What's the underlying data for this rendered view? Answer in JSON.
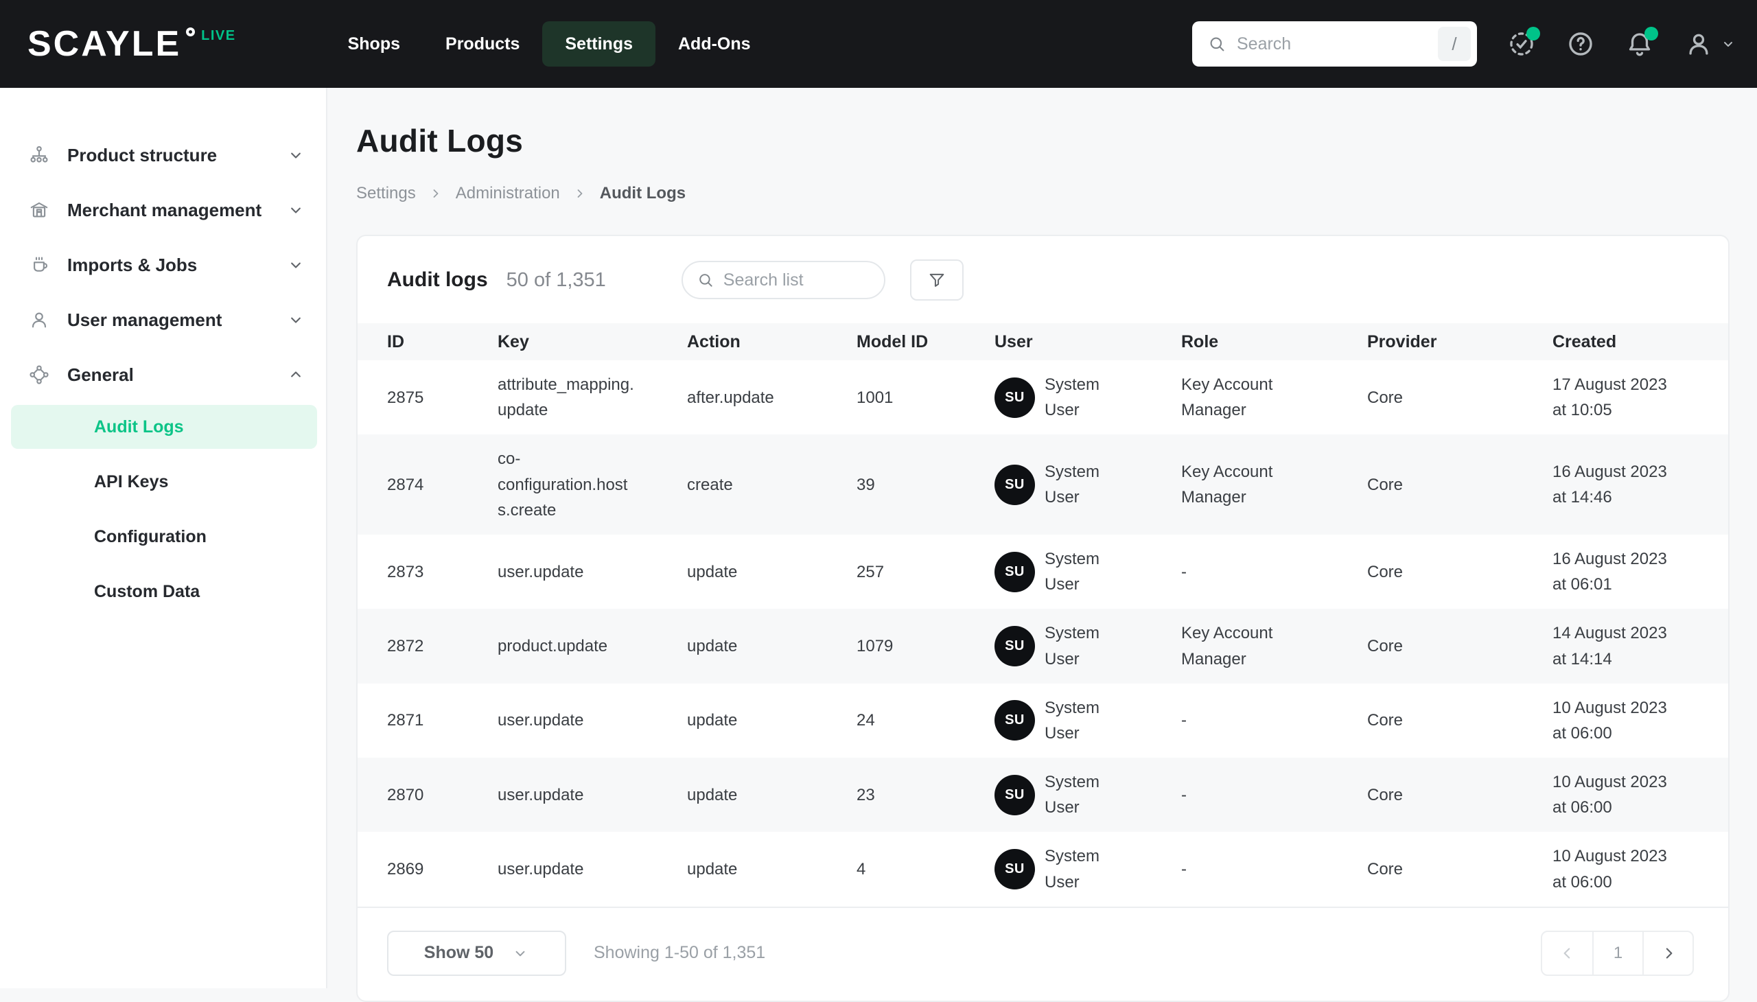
{
  "colors": {
    "accent_green": "#00C389",
    "topbar_bg": "#17181B",
    "topnav_active_bg": "#1E3529",
    "sidebar_active_bg": "#E4F8EF",
    "sidebar_active_text": "#0CC487",
    "page_bg": "#F7F8F9",
    "avatar_bg": "#0E1013"
  },
  "topbar": {
    "logo_text": "SCAYLE",
    "env_badge": "LIVE",
    "nav_items": [
      {
        "label": "Shops",
        "active": false
      },
      {
        "label": "Products",
        "active": false
      },
      {
        "label": "Settings",
        "active": true
      },
      {
        "label": "Add-Ons",
        "active": false
      }
    ],
    "search": {
      "placeholder": "Search",
      "shortcut_key": "/"
    },
    "icons": [
      "status-check-icon",
      "help-icon",
      "notifications-bell-icon",
      "user-avatar-icon",
      "chevron-down-icon"
    ]
  },
  "sidebar": {
    "items": [
      {
        "label": "Product structure",
        "icon": "hierarchy-icon",
        "state": "collapsed"
      },
      {
        "label": "Merchant management",
        "icon": "storefront-icon",
        "state": "collapsed"
      },
      {
        "label": "Imports & Jobs",
        "icon": "coffee-cup-icon",
        "state": "collapsed"
      },
      {
        "label": "User management",
        "icon": "user-icon",
        "state": "collapsed"
      },
      {
        "label": "General",
        "icon": "network-icon",
        "state": "expanded"
      }
    ],
    "general_children": [
      {
        "label": "Audit Logs",
        "active": true
      },
      {
        "label": "API Keys",
        "active": false
      },
      {
        "label": "Configuration",
        "active": false
      },
      {
        "label": "Custom Data",
        "active": false
      }
    ]
  },
  "page": {
    "title": "Audit Logs",
    "breadcrumb": [
      {
        "label": "Settings",
        "current": false
      },
      {
        "label": "Administration",
        "current": false
      },
      {
        "label": "Audit Logs",
        "current": true
      }
    ]
  },
  "card": {
    "title": "Audit logs",
    "count_summary": "50 of 1,351",
    "list_search_placeholder": "Search list",
    "filter_icon": "filter-funnel-icon",
    "table": {
      "columns": [
        "ID",
        "Key",
        "Action",
        "Model ID",
        "User",
        "Role",
        "Provider",
        "Created"
      ],
      "rows": [
        {
          "id": "2875",
          "key": "attribute_mapping.update",
          "action": "after.update",
          "model_id": "1001",
          "user_initials": "SU",
          "user_name": "System User",
          "role": "Key Account Manager",
          "provider": "Core",
          "created_date": "17 August 2023",
          "created_time": "at 10:05"
        },
        {
          "id": "2874",
          "key": "co-configuration.hosts.create",
          "action": "create",
          "model_id": "39",
          "user_initials": "SU",
          "user_name": "System User",
          "role": "Key Account Manager",
          "provider": "Core",
          "created_date": "16 August 2023",
          "created_time": "at 14:46"
        },
        {
          "id": "2873",
          "key": "user.update",
          "action": "update",
          "model_id": "257",
          "user_initials": "SU",
          "user_name": "System User",
          "role": "-",
          "provider": "Core",
          "created_date": "16 August 2023",
          "created_time": "at 06:01"
        },
        {
          "id": "2872",
          "key": "product.update",
          "action": "update",
          "model_id": "1079",
          "user_initials": "SU",
          "user_name": "System User",
          "role": "Key Account Manager",
          "provider": "Core",
          "created_date": "14 August 2023",
          "created_time": "at 14:14"
        },
        {
          "id": "2871",
          "key": "user.update",
          "action": "update",
          "model_id": "24",
          "user_initials": "SU",
          "user_name": "System User",
          "role": "-",
          "provider": "Core",
          "created_date": "10 August 2023",
          "created_time": "at 06:00"
        },
        {
          "id": "2870",
          "key": "user.update",
          "action": "update",
          "model_id": "23",
          "user_initials": "SU",
          "user_name": "System User",
          "role": "-",
          "provider": "Core",
          "created_date": "10 August 2023",
          "created_time": "at 06:00"
        },
        {
          "id": "2869",
          "key": "user.update",
          "action": "update",
          "model_id": "4",
          "user_initials": "SU",
          "user_name": "System User",
          "role": "-",
          "provider": "Core",
          "created_date": "10 August 2023",
          "created_time": "at 06:00"
        }
      ]
    },
    "footer": {
      "page_size_label": "Show 50",
      "showing_label": "Showing 1-50 of 1,351",
      "pagination": {
        "current_page": "1"
      }
    }
  }
}
